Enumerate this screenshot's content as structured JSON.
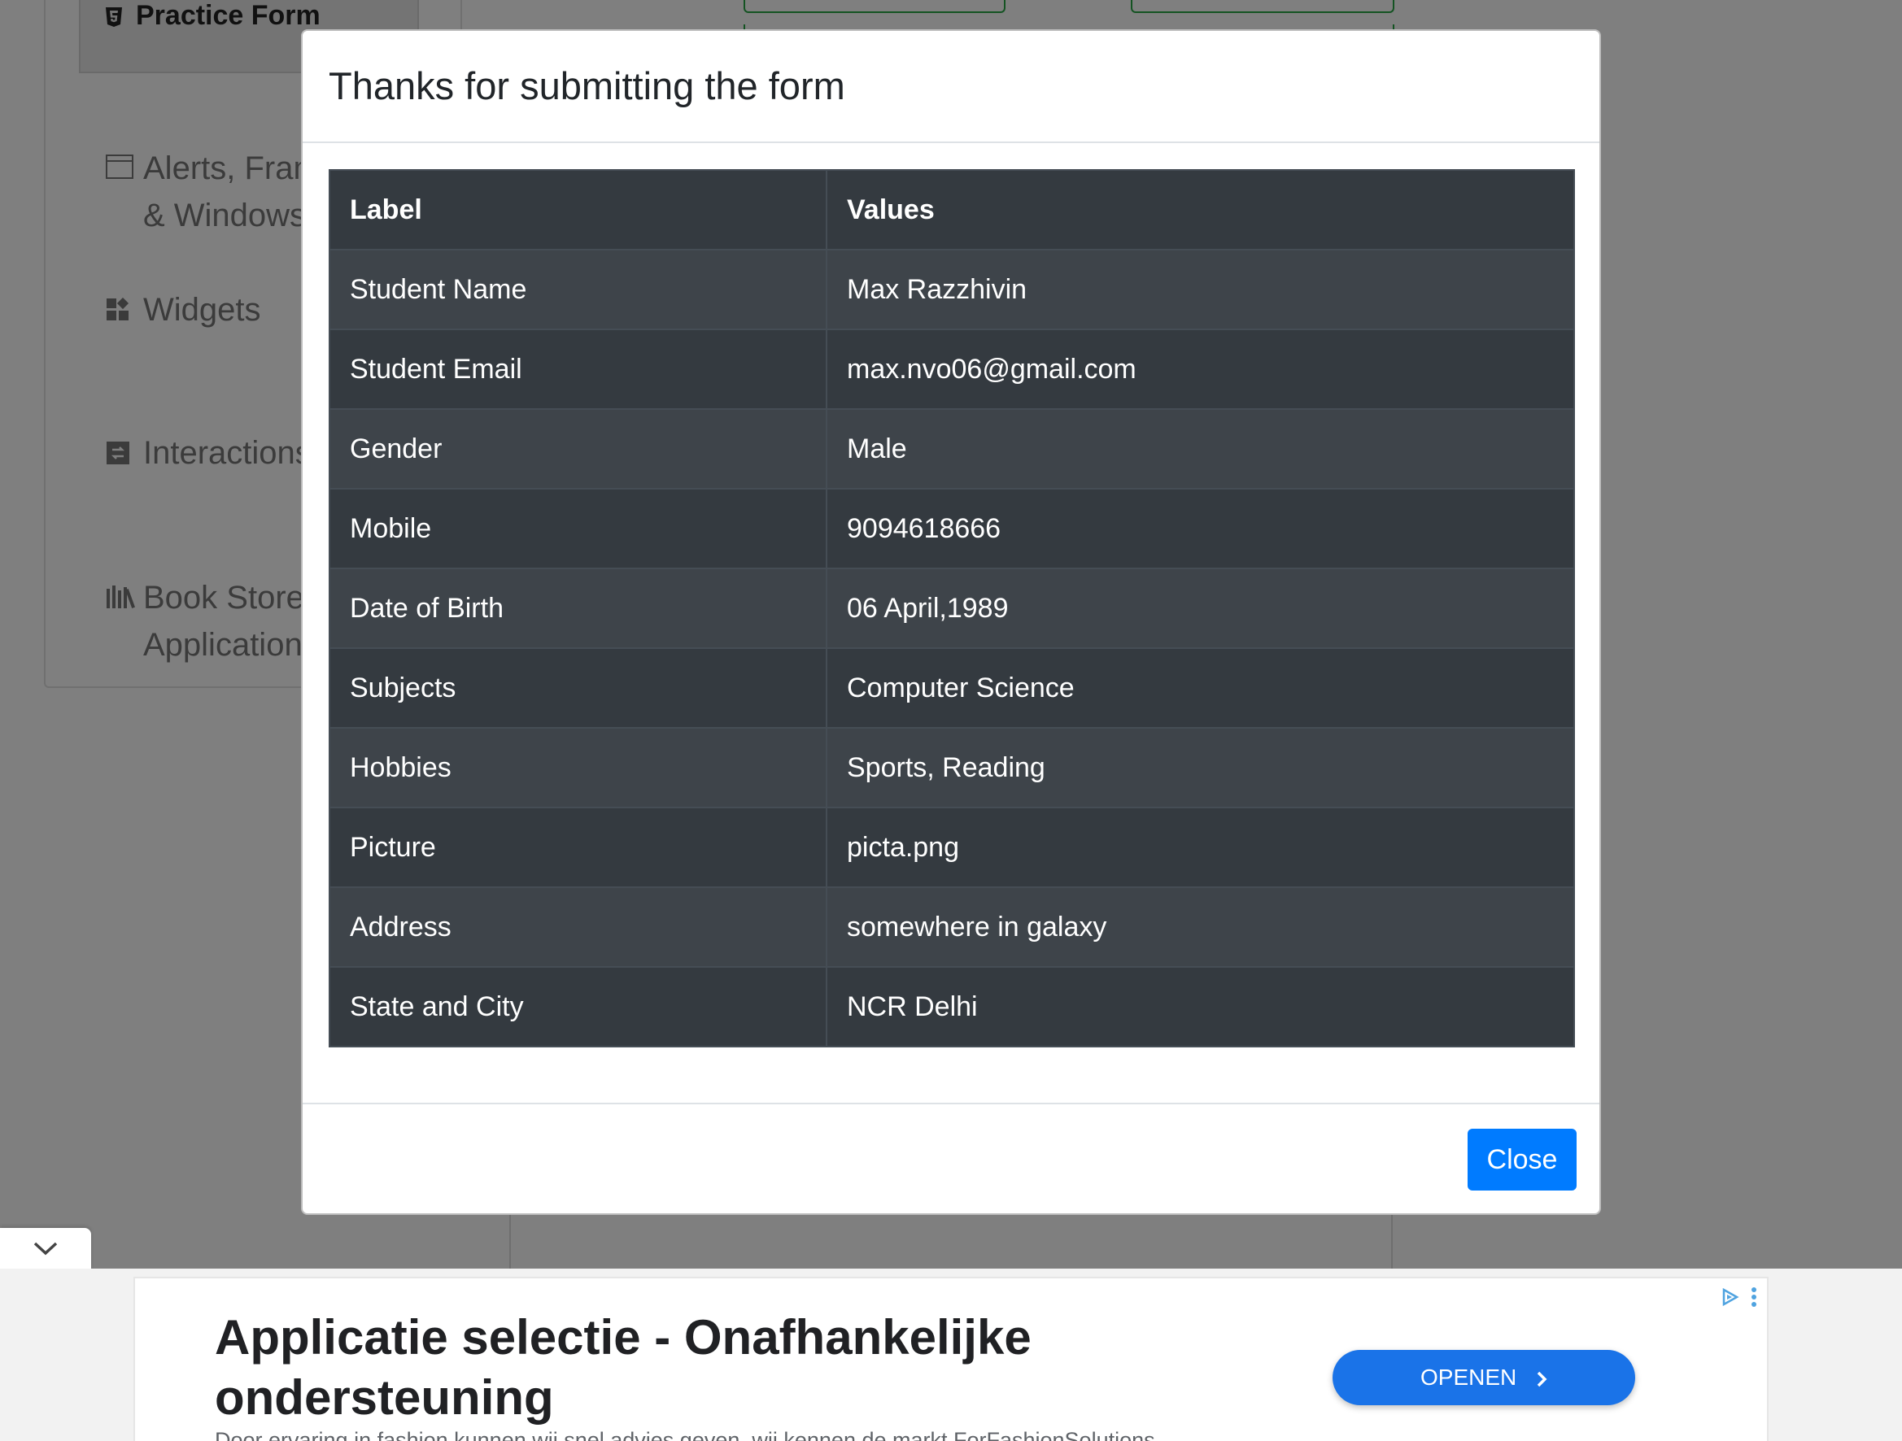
{
  "sidebar": {
    "practice_form": "Practice Form",
    "groups": [
      {
        "line1": "Alerts, Frame",
        "line2": "& Windows",
        "icon": "window-icon"
      },
      {
        "line1": "Widgets",
        "line2": "",
        "icon": "widgets-icon"
      },
      {
        "line1": "Interactions",
        "line2": "",
        "icon": "interactions-icon"
      },
      {
        "line1": "Book Store",
        "line2": "Application",
        "icon": "books-icon"
      }
    ]
  },
  "modal": {
    "title": "Thanks for submitting the form",
    "table": {
      "headers": [
        "Label",
        "Values"
      ],
      "rows": [
        [
          "Student Name",
          "Max Razzhivin"
        ],
        [
          "Student Email",
          "max.nvo06@gmail.com"
        ],
        [
          "Gender",
          "Male"
        ],
        [
          "Mobile",
          "9094618666"
        ],
        [
          "Date of Birth",
          "06 April,1989"
        ],
        [
          "Subjects",
          "Computer Science"
        ],
        [
          "Hobbies",
          "Sports, Reading"
        ],
        [
          "Picture",
          "picta.png"
        ],
        [
          "Address",
          "somewhere in galaxy"
        ],
        [
          "State and City",
          "NCR Delhi"
        ]
      ]
    },
    "close_label": "Close"
  },
  "ad": {
    "title": "Applicatie selectie - Onafhankelijke ondersteuning",
    "description": "Door ervaring in fashion kunnen wij snel advies geven, wij kennen de markt ForFashionSolutions",
    "open_label": "OPENEN"
  },
  "colors": {
    "primary": "#007bff",
    "table_dark": "#343a40",
    "table_stripe": "#3e444a",
    "ad_button": "#1a73e8",
    "form_border": "#28a745"
  }
}
